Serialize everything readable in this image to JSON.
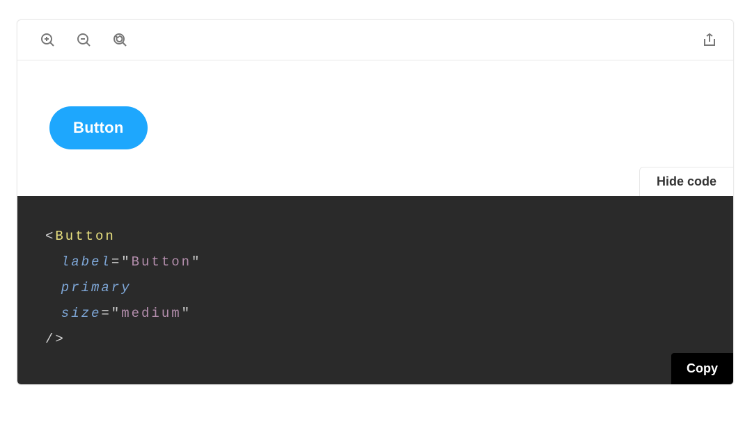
{
  "toolbar": {
    "icons": {
      "zoom_in": "zoom-in-icon",
      "zoom_out": "zoom-out-icon",
      "reset": "reset-zoom-icon",
      "share": "share-icon"
    }
  },
  "preview": {
    "button_label": "Button"
  },
  "actions": {
    "hide_code_label": "Hide code",
    "copy_label": "Copy"
  },
  "code": {
    "component_tag": "Button",
    "props": {
      "label_attr": "label",
      "label_value": "Button",
      "primary_attr": "primary",
      "size_attr": "size",
      "size_value": "medium"
    },
    "open_bracket": "<",
    "close_bracket": "/>",
    "quote_open": "=\"",
    "quote_only": "\""
  }
}
